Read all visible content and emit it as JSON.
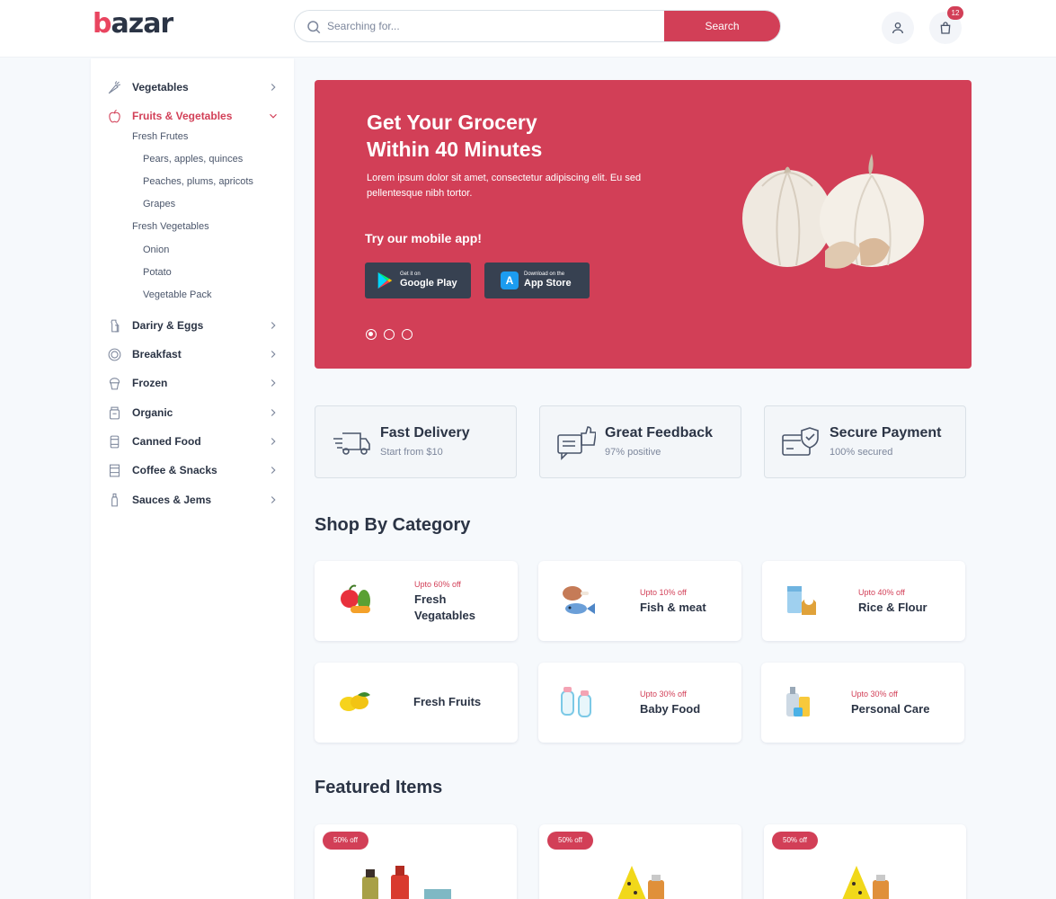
{
  "header": {
    "logo": "bazar",
    "search_placeholder": "Searching for...",
    "search_button": "Search",
    "cart_count": "12"
  },
  "sidebar": {
    "items": [
      {
        "label": "Vegetables",
        "icon": "carrot-icon"
      },
      {
        "label": "Fruits & Vegetables",
        "icon": "apple-icon"
      },
      {
        "label": "Dariry & Eggs",
        "icon": "milk-icon"
      },
      {
        "label": "Breakfast",
        "icon": "plate-icon"
      },
      {
        "label": "Frozen",
        "icon": "ice-cream-icon"
      },
      {
        "label": "Organic",
        "icon": "jar-icon"
      },
      {
        "label": "Canned Food",
        "icon": "can-icon"
      },
      {
        "label": "Coffee & Snacks",
        "icon": "coffee-icon"
      },
      {
        "label": "Sauces & Jems",
        "icon": "bottle-icon"
      }
    ],
    "fruits_sub": {
      "fresh_frutes": "Fresh Frutes",
      "pears": "Pears, apples, quinces",
      "peaches": "Peaches, plums, apricots",
      "grapes": "Grapes",
      "fresh_vegetables": "Fresh Vegetables",
      "onion": "Onion",
      "potato": "Potato",
      "vegetable_pack": "Vegetable Pack"
    }
  },
  "banner": {
    "title_line1": "Get Your Grocery",
    "title_line2": "Within 40 Minutes",
    "desc_line1": "Lorem ipsum dolor sit amet, consectetur adipiscing elit. Eu sed",
    "desc_line2": "pellentesque nibh tortor.",
    "try_label": "Try our mobile app!",
    "google_small": "Get it on",
    "google_big": "Google Play",
    "apple_small": "Download on the",
    "apple_big": "App Store",
    "active_slide": 1
  },
  "services": [
    {
      "title": "Fast Delivery",
      "subtitle": "Start from $10",
      "icon": "truck-icon"
    },
    {
      "title": "Great Feedback",
      "subtitle": "97% positive",
      "icon": "feedback-icon"
    },
    {
      "title": "Secure Payment",
      "subtitle": "100% secured",
      "icon": "secure-card-icon"
    }
  ],
  "shop_by_category_title": "Shop By Category",
  "categories": [
    {
      "off": "Upto 60% off",
      "name_line1": "Fresh",
      "name_line2": "Vegatables"
    },
    {
      "off": "Upto 10% off",
      "name": "Fish & meat"
    },
    {
      "off": "Upto 40% off",
      "name": "Rice & Flour"
    },
    {
      "name": "Fresh Fruits"
    },
    {
      "off": "Upto 30% off",
      "name": "Baby Food"
    },
    {
      "off": "Upto 30% off",
      "name": "Personal Care"
    }
  ],
  "featured_title": "Featured Items",
  "featured": [
    {
      "discount": "50% off"
    },
    {
      "discount": "50% off"
    },
    {
      "discount": "50% off"
    }
  ],
  "colors": {
    "accent": "#d23f57",
    "text": "#2b3445",
    "muted": "#7d879c",
    "bg": "#f6f9fc"
  }
}
